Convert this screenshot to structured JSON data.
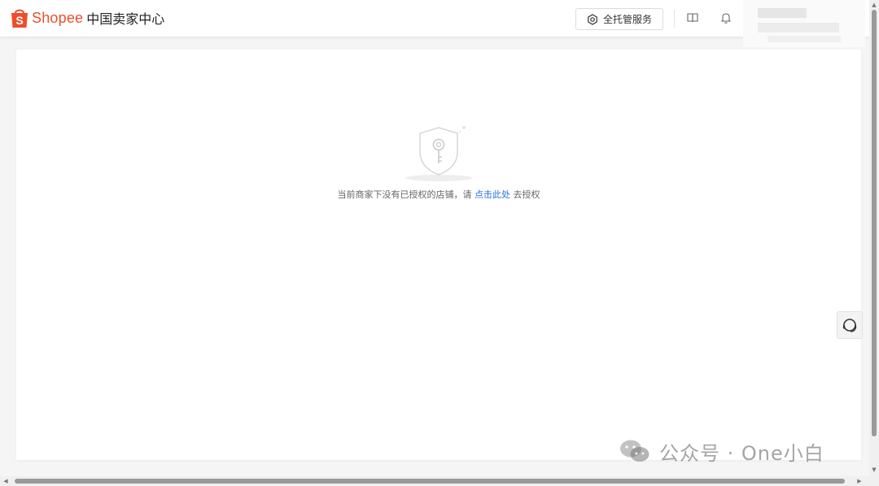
{
  "header": {
    "brand": "Shopee",
    "brand_suffix": "中国卖家中心",
    "full_service_label": "全托管服务",
    "brand_color": "#ee4d2d"
  },
  "main": {
    "empty_text_before": "当前商家下没有已授权的店铺，请",
    "empty_link": "点击此处",
    "empty_text_after": "去授权",
    "link_color": "#2673dd"
  },
  "icons": {
    "full_service": "hexagon-gear-icon",
    "guide": "book-icon",
    "notifications": "bell-icon",
    "support": "headset-icon",
    "empty_state": "shield-key-icon"
  },
  "watermark": {
    "text": "公众号 · One小白"
  }
}
